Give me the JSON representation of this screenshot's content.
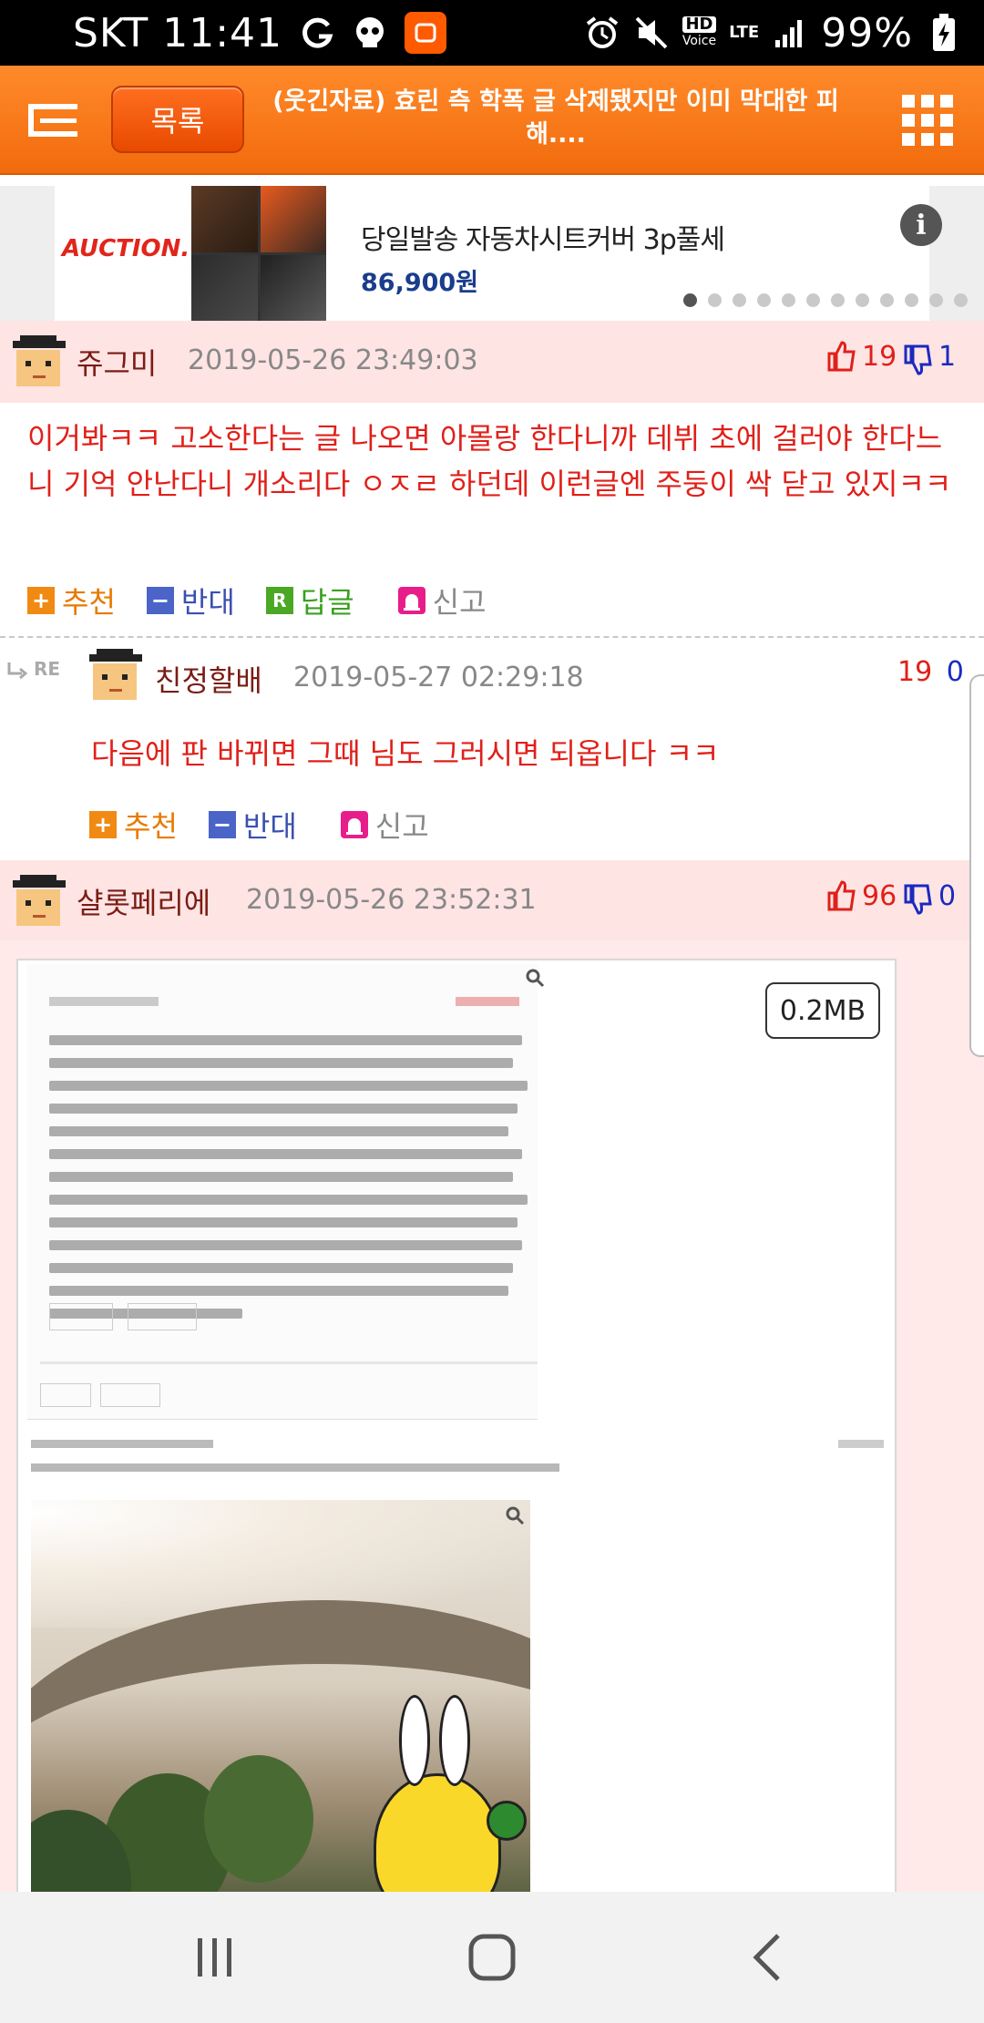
{
  "status_bar": {
    "carrier_time": "SKT 11:41",
    "hd_label": "HD",
    "voice_label": "Voice",
    "lte_label": "LTE",
    "battery": "99%"
  },
  "header": {
    "list_button": "목록",
    "title": "(웃긴자료) 효린 측 학폭 글 삭제됐지만 이미 막대한 피해...."
  },
  "ad": {
    "brand": "AUCTION.",
    "title": "당일발송 자동차시트커버 3p풀세",
    "price": "86,900원",
    "info": "i"
  },
  "comments": [
    {
      "nick": "쥬그미",
      "date": "2019-05-26 23:49:03",
      "up": "19",
      "down": "1",
      "body": "이거봐ㅋㅋ 고소한다는 글 나오면 아몰랑 한다니까 데뷔 초에 걸러야 한다느니 기억 안난다니 개소리다 ㅇㅈㄹ 하던데 이런글엔 주둥이 싹 닫고 있지ㅋㅋ"
    },
    {
      "nick": "친정할배",
      "date": "2019-05-27 02:29:18",
      "up": "19",
      "down": "0",
      "body": "다음에 판 바뀌면 그때 님도 그러시면 되옵니다 ㅋㅋ"
    },
    {
      "nick": "샬롯페리에",
      "date": "2019-05-26 23:52:31",
      "up": "96",
      "down": "0"
    }
  ],
  "actions": {
    "recommend": "추천",
    "oppose": "반대",
    "reply": "답글",
    "report": "신고",
    "reply_icon": "R"
  },
  "re_mark": "RE",
  "attachment": {
    "size": "0.2MB"
  },
  "icons": {
    "menu": "menu-icon",
    "grid": "grid-icon",
    "thumb_up": "thumbs-up-icon",
    "thumb_down": "thumbs-down-icon"
  },
  "colors": {
    "header_orange": "#f26b0d",
    "comment_red": "#e0201a",
    "highlight_pink": "#ffe4e4",
    "down_blue": "#1a2ac0"
  }
}
